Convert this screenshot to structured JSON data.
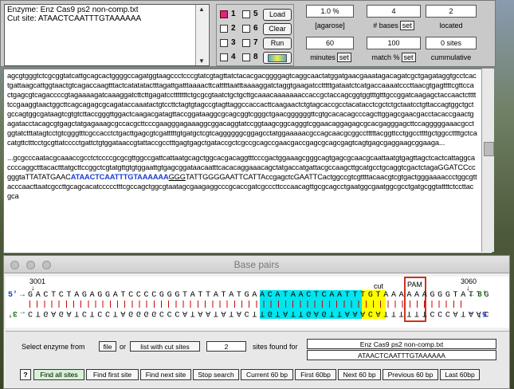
{
  "enzyme": {
    "line1": "Enzyme: Enz Cas9 ps2 non-comp.txt",
    "line2": "Cut site: ATAACTCAATTTGTAAAAAA"
  },
  "checkboxes": [
    {
      "num": "1",
      "checked": true
    },
    {
      "num": "2",
      "checked": false
    },
    {
      "num": "3",
      "checked": false
    },
    {
      "num": "4",
      "checked": false
    },
    {
      "num": "5",
      "checked": false
    },
    {
      "num": "6",
      "checked": false
    },
    {
      "num": "7",
      "checked": false
    },
    {
      "num": "8",
      "checked": false
    }
  ],
  "buttons": {
    "load": "Load",
    "clear": "Clear",
    "run": "Run"
  },
  "stats": {
    "percent": "1.0 %",
    "agarose": "[agarose]",
    "bases_value": "4",
    "bases_label": "# bases",
    "located_value": "2",
    "located_label": "located",
    "minutes_value": "60",
    "minutes_label": "minutes",
    "match_value": "100",
    "match_label": "match %",
    "sites_value": "0 sites",
    "cumulative_label": "cummulative",
    "set": "set"
  },
  "sequence": {
    "p1": "agcgtgggtctcgcggtatcattgcagcactggggccagatggtaagccctcccgtatcgtagttatctacacgacggggagtcaggcaactatggatgaacgaaatagacagatcgctgagataggtgcctcactgattaagcattggtaactgtcagaccaagtttactcatatatactttagattgatttaaaacttcatttttaatttaaaaggatctaggtgaagatcctttttgataatctcatgaccaaaatcccttaacgtgagttttcgttccactgagcgtcagaccccgtagaaaagatcaaaggatcttcttgagatcctttttttctgcgcgtaatctgctgcttgcaaacaaaaaaaccaccgctaccagcggtggtttgtttgccggatcaagagctaccaactctttttccgaaggtaactggcttcagcagagcgcagataccaaatactgtccttctagtgtagccgtagttaggccaccacttcaagaactctgtagcaccgcctacatacctcgctctgctaatcctgttaccagtggctgctgccagtggcgataagtcgtgtcttaccgggttggactcaagacgatagttaccggataaggcgcagcggtcgggctgaacggggggttcgtgcacacagcccagcttggagcgaacgacctacaccgaactgagatacctacagcgtgagctatgagaaagcgccacgcttcccgaagggagaaaggcggacaggtatccggtaagcggcagggtcggaacaggagagcgcacgagggagcttccagggggaaacgcctggtatctttatagtcctgtcgggtttcgccacctctgacttgagcgtcgatttttgtgatgctcgtcaggggggcggagcctatggaaaaacgccagcaacgcggcctttttacggttcctggccttttgctggccttttgctcacatgttctttcctgcgttatcccctgattctgtggataaccgtattaccgcctttgagtgagctgataccgctcgccgcagccgaacgaccgagcgcagcgagtcagtgagcgaggaagcggaaga...",
    "p2a": "...gcgcccaatacgcaaaccgcctctccccgcgcgttggccgattcattaatgcagctggcacgacaggtttcccgactggaaagcgggcagtgagcgcaacgcaattaatgtgagttagctcactcattaggcaccccaggctttacactttatgcttccggctcgtatgttgtgtggaattgtgagcggataacaatttcacacaggaaacagctatgaccatgattacgccaagcttgcatgcctgcaggtcgactctagaGGATCCccgggtaTTATATGAAC",
    "p2b": "ATAACTCAATTTGTAAAAAA",
    "p2c": "GGG",
    "p2d": "TATTGGGGAATTCATTAccgagctcGAATTCactggccgtcgttttacaacgtcgtgactgggaaaaccctggcgttacccaacttaatcgccttgcagcacatccccctttcgccagctggcgtaatagcgaagaggcccgcaccgatcgcccttcccaacagttgcgcagcctgaatggcgaatggcgcctgatgcggtattttctccttacgca"
  },
  "basepairs": {
    "title": "Base pairs",
    "start_pos": "3001",
    "end_pos": "3060",
    "label_5": "5'",
    "label_3": "3'",
    "top_strand": "GACTCTAGAGGATCCCCGGGTATTATATGAACATAACTCAATTTGTAAAAAAGGGTATTG",
    "bottom_strand": "CTGAGATCTCCTAGGGGCCCATAATATACTTGTATTGAGTTAAACATTTTTTCCCATAAC",
    "cut_label": "cut",
    "pam_label": "PAM"
  },
  "bottom": {
    "select_text": "Select enzyme from",
    "file_btn": "file",
    "or_text": "or",
    "list_btn": "list with cut sites",
    "sites_count": "2",
    "sites_found_text": "sites found for",
    "enzyme_file": "Enz Cas9 ps2 non-comp.txt",
    "cut_seq": "ATAACTCAATTTGTAAAAAA",
    "help": "?",
    "find_all": "Find all sites",
    "find_first": "Find first site",
    "find_next": "Find next site",
    "stop": "Stop search",
    "current": "Current 60 bp",
    "first": "First 60bp",
    "next": "Next 60 bp",
    "previous": "Previous 60 bp",
    "last": "Last 60bp"
  },
  "colors": {
    "highlight_cyan": "#00e5ee",
    "highlight_yellow": "#ffff00",
    "pam_box": "#d03020",
    "seq_blue": "#1a3dd6",
    "checkbox_on": "#e0208c"
  }
}
